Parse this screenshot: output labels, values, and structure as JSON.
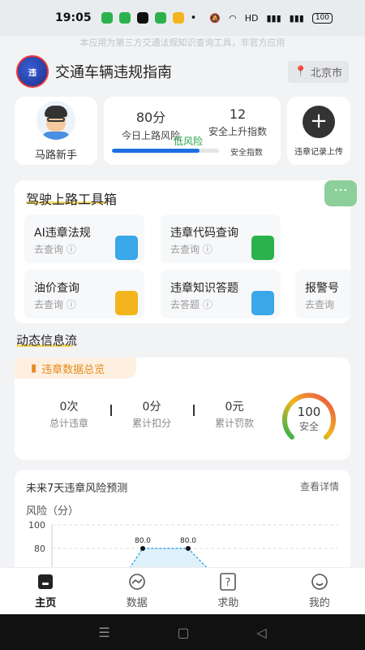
{
  "status_bar": {
    "time": "19:05",
    "battery": "100"
  },
  "notice": "本应用为第三方交通法规知识查询工具，非官方应用",
  "header": {
    "logo_text": "违",
    "title": "交通车辆违规指南",
    "location": "北京市"
  },
  "profile": {
    "name": "马路新手"
  },
  "stats": {
    "risk_score": "80分",
    "risk_label": "今日上路风险",
    "safety_index": "12",
    "safety_label": "安全上升指数",
    "risk_level": "低风险",
    "bar_caption": "安全指数",
    "progress": 0.82
  },
  "upload": {
    "label": "违章记录上传"
  },
  "toolbox": {
    "title": "驾驶上路工具箱",
    "more_icon": "more-icon",
    "tools": [
      {
        "name": "AI违章法规",
        "sub": "去查询",
        "color": "#3aa8e8"
      },
      {
        "name": "违章代码查询",
        "sub": "去查询",
        "color": "#2bb24c"
      },
      {
        "name": "油价查询",
        "sub": "去查询",
        "color": "#f2b51d"
      },
      {
        "name": "违章知识答题",
        "sub": "去答题",
        "color": "#3aa8e8"
      },
      {
        "name": "报警号",
        "sub": "去查询",
        "color": "#3aa8e8"
      }
    ]
  },
  "feed": {
    "title": "动态信息流"
  },
  "overview": {
    "tag": "违章数据总览",
    "items": [
      {
        "value": "0次",
        "label": "总计违章"
      },
      {
        "value": "0分",
        "label": "累计扣分"
      },
      {
        "value": "0元",
        "label": "累计罚款"
      }
    ],
    "score": "100",
    "score_label": "安全"
  },
  "forecast": {
    "title": "未来7天违章风险预测",
    "link": "查看详情",
    "ylabel": "风险（分）"
  },
  "chart_data": {
    "type": "area",
    "ylabel": "风险（分）",
    "y_ticks": [
      "100",
      "80"
    ],
    "ylim": [
      0,
      100
    ],
    "values": [
      80.0,
      80.0
    ],
    "labels": [
      "80.0",
      "80.0"
    ],
    "grid": true
  },
  "tabs": [
    {
      "label": "主页",
      "icon": "home-icon",
      "active": true
    },
    {
      "label": "数据",
      "icon": "chart-icon",
      "active": false
    },
    {
      "label": "求助",
      "icon": "help-icon",
      "active": false
    },
    {
      "label": "我的",
      "icon": "profile-icon",
      "active": false
    }
  ]
}
